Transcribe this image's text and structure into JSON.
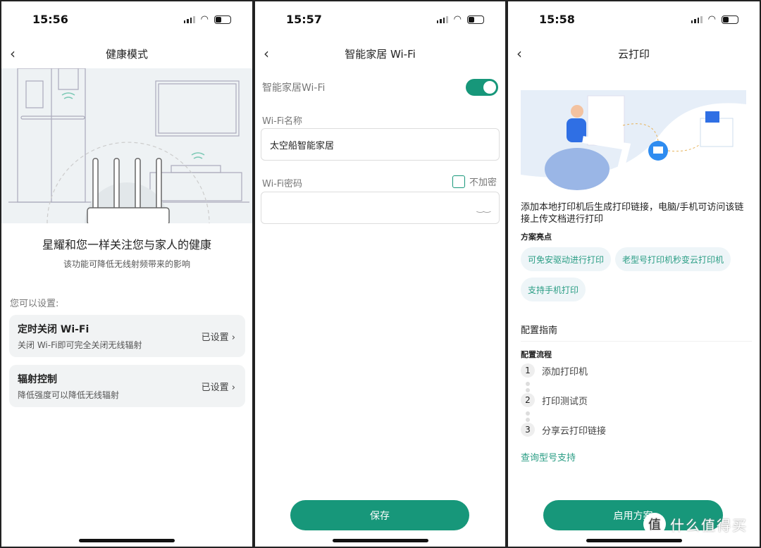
{
  "screens": [
    {
      "time": "15:56",
      "title": "健康模式",
      "heading": "星耀和您一样关注您与家人的健康",
      "subheading": "该功能可降低无线射频带来的影响",
      "section": "您可以设置:",
      "items": [
        {
          "title": "定时关闭 Wi-Fi",
          "desc": "关闭 Wi-Fi即可完全关闭无线辐射",
          "status": "已设置"
        },
        {
          "title": "辐射控制",
          "desc": "降低强度可以降低无线辐射",
          "status": "已设置"
        }
      ]
    },
    {
      "time": "15:57",
      "title": "智能家居 Wi-Fi",
      "toggle_label": "智能家居Wi-Fi",
      "toggle_on": true,
      "name_label": "Wi-Fi名称",
      "name_value": "太空船智能家居",
      "pwd_label": "Wi-Fi密码",
      "no_encrypt_label": "不加密",
      "no_encrypt_checked": false,
      "pwd_value": "",
      "save": "保存"
    },
    {
      "time": "15:58",
      "title": "云打印",
      "desc": "添加本地打印机后生成打印链接，电脑/手机可访问该链接上传文档进行打印",
      "highlights_title": "方案亮点",
      "highlights": [
        "可免安驱动进行打印",
        "老型号打印机秒变云打印机",
        "支持手机打印"
      ],
      "guide_title": "配置指南",
      "flow_title": "配置流程",
      "steps": [
        {
          "n": "1",
          "label": "添加打印机"
        },
        {
          "n": "2",
          "label": "打印测试页"
        },
        {
          "n": "3",
          "label": "分享云打印链接"
        }
      ],
      "link": "查询型号支持",
      "enable": "启用方案",
      "watermark": "值 什么值得买"
    }
  ],
  "colors": {
    "accent": "#17977a",
    "chip_text": "#2a9d84",
    "illustration_bg": "#eef2f4"
  }
}
